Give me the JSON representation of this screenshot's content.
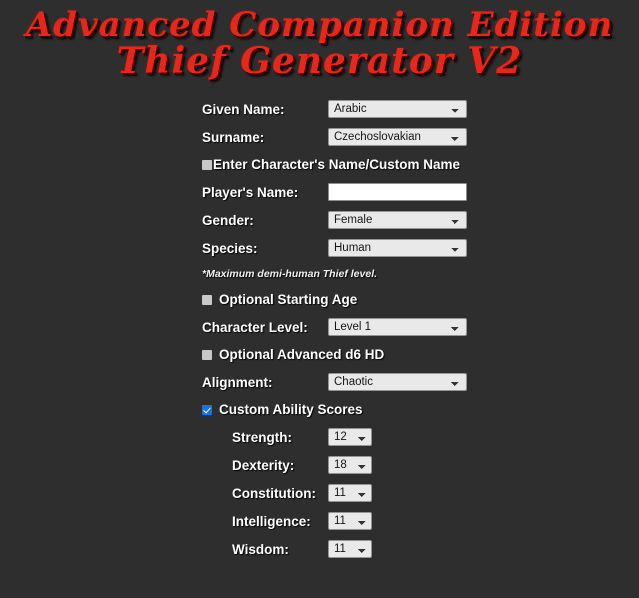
{
  "title": {
    "line1": "Advanced Companion Edition",
    "line2": "Thief Generator V2",
    "color": "#e5271c"
  },
  "form": {
    "given_name": {
      "label": "Given Name:",
      "value": "Arabic"
    },
    "surname": {
      "label": "Surname:",
      "value": "Czechoslovakian"
    },
    "custom_name_toggle": {
      "label": "Enter Character's Name/Custom Name",
      "checked": false
    },
    "player_name": {
      "label": "Player's Name:",
      "value": "",
      "placeholder": ""
    },
    "gender": {
      "label": "Gender:",
      "value": "Female"
    },
    "species": {
      "label": "Species:",
      "value": "Human"
    },
    "species_note": "*Maximum demi-human Thief level.",
    "starting_age_toggle": {
      "label": "Optional Starting Age",
      "checked": false
    },
    "character_level": {
      "label": "Character Level:",
      "value": "Level 1"
    },
    "advanced_hd_toggle": {
      "label": "Optional Advanced d6 HD",
      "checked": false
    },
    "alignment": {
      "label": "Alignment:",
      "value": "Chaotic"
    },
    "custom_ability_toggle": {
      "label": "Custom Ability Scores",
      "checked": true
    },
    "abilities": [
      {
        "label": "Strength:",
        "value": "12"
      },
      {
        "label": "Dexterity:",
        "value": "18"
      },
      {
        "label": "Constitution:",
        "value": "11"
      },
      {
        "label": "Intelligence:",
        "value": "11"
      },
      {
        "label": "Wisdom:",
        "value": "11"
      }
    ]
  },
  "theme": {
    "background": "#2e2e2e",
    "label_color": "#ffffff",
    "select_background": "#e9e9e9",
    "checkbox_checked_color": "#1673e6"
  }
}
